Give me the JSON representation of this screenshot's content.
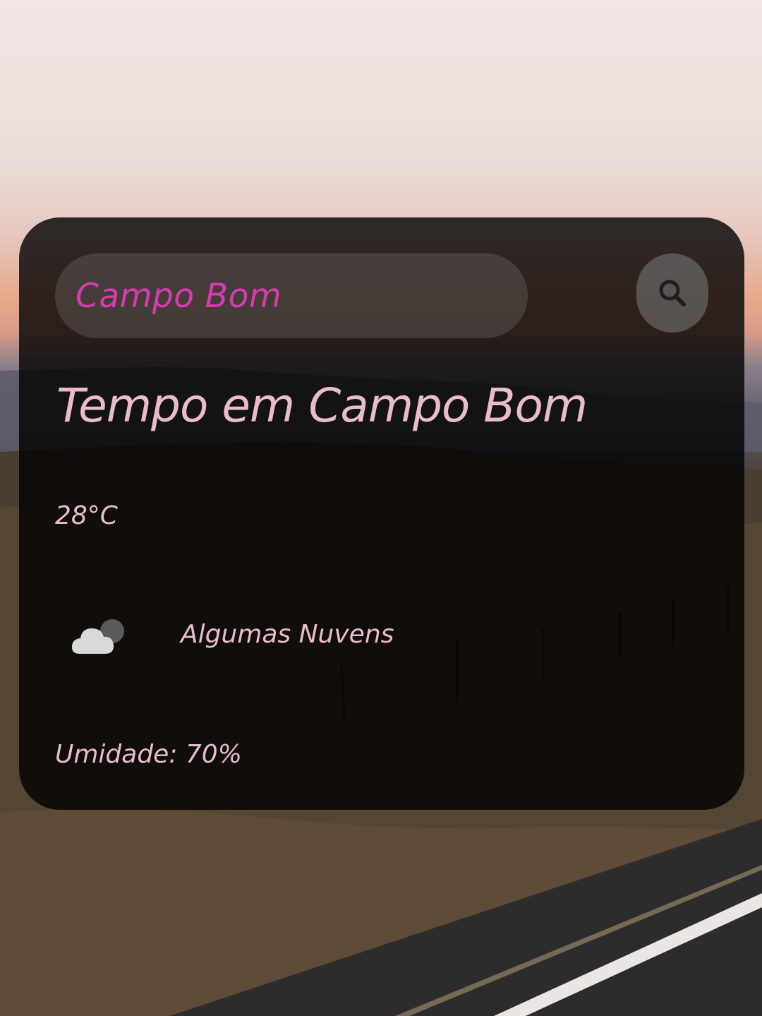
{
  "search": {
    "value": "Campo Bom",
    "placeholder": "",
    "button_icon": "search-icon"
  },
  "weather": {
    "title": "Tempo em Campo Bom",
    "temperature": "28°C",
    "condition_icon": "partly-cloudy-icon",
    "description": "Algumas Nuvens",
    "humidity": "Umidade: 70%"
  },
  "colors": {
    "accent_text": "#d63cb0",
    "primary_text": "#e8bccc",
    "card_background": "rgba(0,0,0,0.80)"
  }
}
